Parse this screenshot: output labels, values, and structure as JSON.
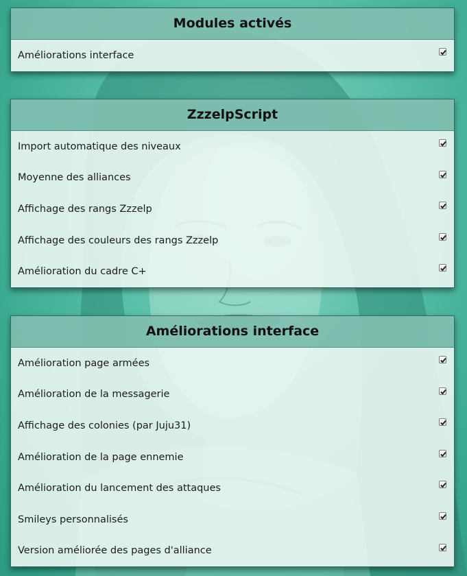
{
  "colors": {
    "background": "#5cc2ad",
    "header": "#80beb0",
    "body": "#f0f8f6"
  },
  "panels": [
    {
      "title": "Modules activés",
      "items": [
        {
          "label": "Améliorations interface",
          "checked": true
        }
      ]
    },
    {
      "title": "ZzzelpScript",
      "items": [
        {
          "label": "Import automatique des niveaux",
          "checked": true
        },
        {
          "label": "Moyenne des alliances",
          "checked": true
        },
        {
          "label": "Affichage des rangs Zzzelp",
          "checked": true
        },
        {
          "label": "Affichage des couleurs des rangs Zzzelp",
          "checked": true
        },
        {
          "label": "Amélioration du cadre C+",
          "checked": true
        }
      ]
    },
    {
      "title": "Améliorations interface",
      "items": [
        {
          "label": "Amélioration page armées",
          "checked": true
        },
        {
          "label": "Amélioration de la messagerie",
          "checked": true
        },
        {
          "label": "Affichage des colonies (par Juju31)",
          "checked": true
        },
        {
          "label": "Amélioration de la page ennemie",
          "checked": true
        },
        {
          "label": "Amélioration du lancement des attaques",
          "checked": true
        },
        {
          "label": "Smileys personnalisés",
          "checked": true
        },
        {
          "label": "Version améliorée des pages d'alliance",
          "checked": true
        }
      ]
    }
  ]
}
